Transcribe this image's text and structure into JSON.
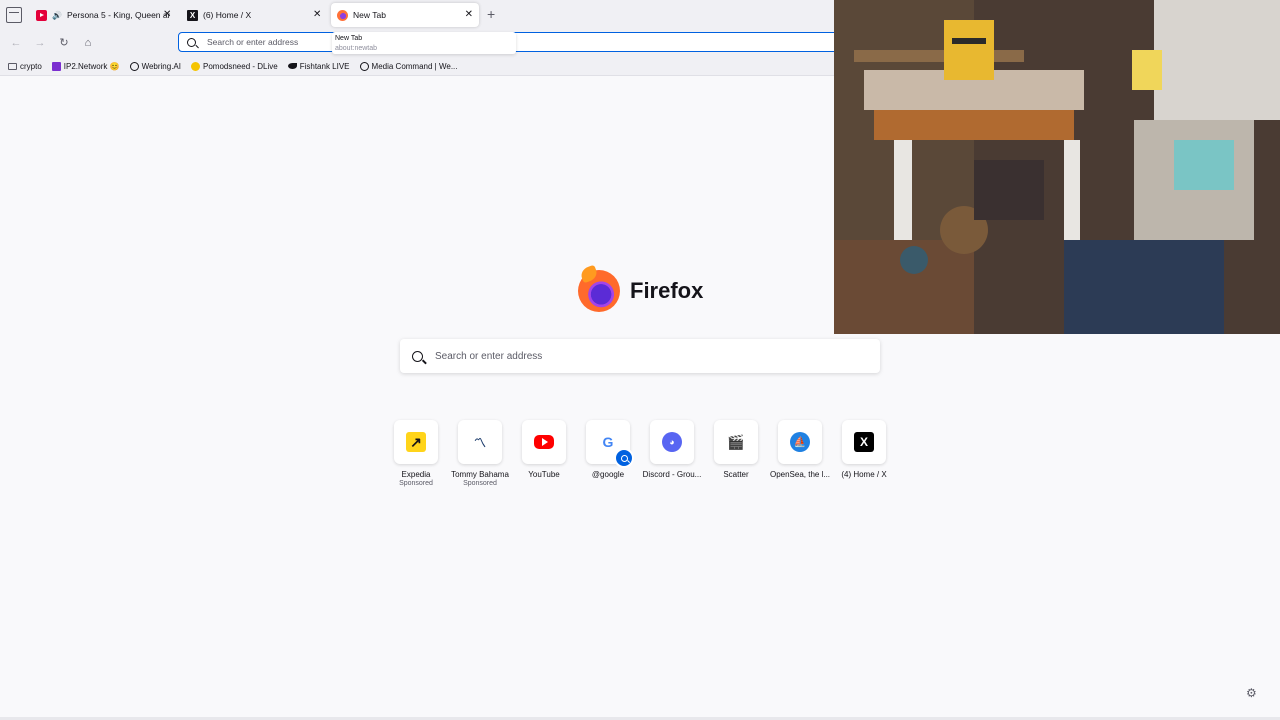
{
  "tabs": [
    {
      "title": "Persona 5 - King, Queen ar",
      "favicon": "youtube-icon",
      "audio": true
    },
    {
      "title": "(6) Home / X",
      "favicon": "x-icon",
      "audio": false
    },
    {
      "title": "New Tab",
      "favicon": "firefox-icon",
      "audio": false,
      "active": true
    }
  ],
  "tooltip": {
    "title": "New Tab",
    "url": "about:newtab"
  },
  "urlbar": {
    "placeholder": "Search or enter address"
  },
  "bookmarks": [
    {
      "label": "crypto",
      "icon": "folder-icon"
    },
    {
      "label": "IP2.Network 😊",
      "icon": "ip2-icon"
    },
    {
      "label": "Webring.AI",
      "icon": "webring-icon"
    },
    {
      "label": "Pomodsneed - DLive",
      "icon": "dlive-icon"
    },
    {
      "label": "Fishtank LIVE",
      "icon": "fishtank-icon"
    },
    {
      "label": "Media Command | We...",
      "icon": "media-command-icon"
    }
  ],
  "logo": {
    "text": "Firefox"
  },
  "search": {
    "placeholder": "Search or enter address"
  },
  "shortcuts": [
    {
      "label": "Expedia",
      "sponsored": "Sponsored",
      "icon": "expedia-icon",
      "glyph": "↗"
    },
    {
      "label": "Tommy Bahama",
      "sponsored": "Sponsored",
      "icon": "tommy-bahama-icon",
      "glyph": "〽"
    },
    {
      "label": "YouTube",
      "sponsored": "",
      "icon": "youtube-icon",
      "glyph": ""
    },
    {
      "label": "@google",
      "sponsored": "",
      "icon": "google-icon",
      "glyph": "G"
    },
    {
      "label": "Discord - Grou...",
      "sponsored": "",
      "icon": "discord-icon",
      "glyph": "◕"
    },
    {
      "label": "Scatter",
      "sponsored": "",
      "icon": "scatter-icon",
      "glyph": "🎬"
    },
    {
      "label": "OpenSea, the l...",
      "sponsored": "",
      "icon": "opensea-icon",
      "glyph": "⛵"
    },
    {
      "label": "(4) Home / X",
      "sponsored": "",
      "icon": "x-icon",
      "glyph": "X"
    }
  ],
  "colors": {
    "accent": "#0061e0",
    "background": "#f9f9fb",
    "toolbar": "#f0f0f4"
  }
}
